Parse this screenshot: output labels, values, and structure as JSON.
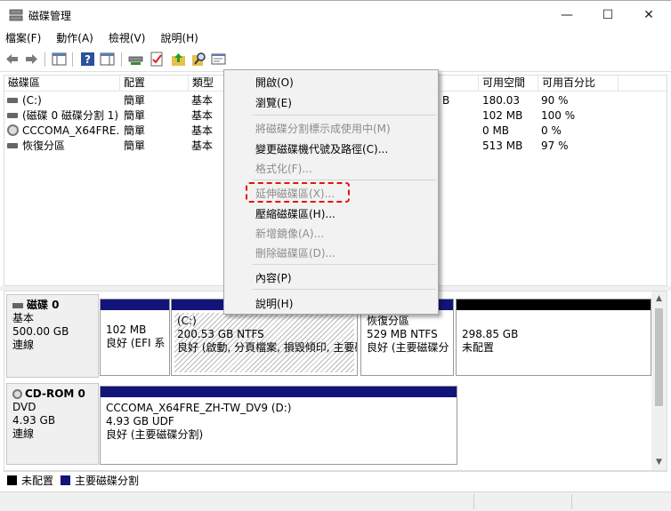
{
  "window": {
    "title": "磁碟管理",
    "minimize_glyph": "—",
    "maximize_glyph": "☐",
    "close_glyph": "✕"
  },
  "menubar": {
    "items": [
      "檔案(F)",
      "動作(A)",
      "檢視(V)",
      "說明(H)"
    ]
  },
  "toolbar": {
    "icons": [
      "back-arrow-icon",
      "forward-arrow-icon",
      "console-tree-icon",
      "help-icon",
      "action-pane-icon",
      "connect-icon",
      "checklist-icon",
      "up-folder-icon",
      "search-icon",
      "properties-icon"
    ]
  },
  "volume_list": {
    "columns": [
      "磁碟區",
      "配置",
      "類型",
      "",
      "可用空間",
      "可用百分比"
    ],
    "rows": [
      {
        "name": "(C:)",
        "layout": "簡單",
        "type": "基本",
        "free": "180.03",
        "free_suffix_hidden": "GB",
        "pct": "90 %"
      },
      {
        "name": "(磁碟 0 磁碟分割 1)",
        "layout": "簡單",
        "type": "基本",
        "free": "102 MB",
        "pct": "100 %"
      },
      {
        "name": "CCCOMA_X64FRE...",
        "layout": "簡單",
        "type": "基本",
        "free": "0 MB",
        "pct": "0 %"
      },
      {
        "name": "恢復分區",
        "layout": "簡單",
        "type": "基本",
        "free": "513 MB",
        "pct": "97 %"
      }
    ],
    "partial_visible_text": "B"
  },
  "disks": [
    {
      "name": "磁碟 0",
      "type": "基本",
      "size": "500.00 GB",
      "status": "連線",
      "partitions": [
        {
          "title": "",
          "size": "102 MB",
          "status": "良好 (EFI 系"
        },
        {
          "title": "(C:)",
          "size": "200.53 GB NTFS",
          "status": "良好 (啟動, 分頁檔案, 損毀傾印, 主要磁"
        },
        {
          "title": "恢復分區",
          "size": "529 MB NTFS",
          "status": "良好 (主要磁碟分"
        },
        {
          "title": "",
          "size": "298.85 GB",
          "status": "未配置"
        }
      ]
    },
    {
      "name": "CD-ROM 0",
      "type": "DVD",
      "size": "4.93 GB",
      "status": "連線",
      "partitions": [
        {
          "title": "CCCOMA_X64FRE_ZH-TW_DV9 (D:)",
          "size": "4.93 GB UDF",
          "status": "良好 (主要磁碟分割)"
        }
      ]
    }
  ],
  "legend": [
    {
      "label": "未配置",
      "color": "#000000"
    },
    {
      "label": "主要磁碟分割",
      "color": "#12147a"
    }
  ],
  "context_menu": {
    "items": [
      {
        "label": "開啟(O)",
        "enabled": true
      },
      {
        "label": "瀏覽(E)",
        "enabled": true
      },
      {
        "label": "將磁碟分割標示成使用中(M)",
        "enabled": false
      },
      {
        "label": "變更磁碟機代號及路徑(C)...",
        "enabled": true
      },
      {
        "label": "格式化(F)...",
        "enabled": false
      },
      {
        "label": "延伸磁碟區(X)...",
        "enabled": false
      },
      {
        "label": "壓縮磁碟區(H)...",
        "enabled": true
      },
      {
        "label": "新增鏡像(A)...",
        "enabled": false
      },
      {
        "label": "刪除磁碟區(D)...",
        "enabled": false
      },
      {
        "label": "內容(P)",
        "enabled": true
      },
      {
        "label": "說明(H)",
        "enabled": true
      }
    ],
    "highlighted_item": "延伸磁碟區(X)...",
    "highlight_color": "#e4140c"
  }
}
